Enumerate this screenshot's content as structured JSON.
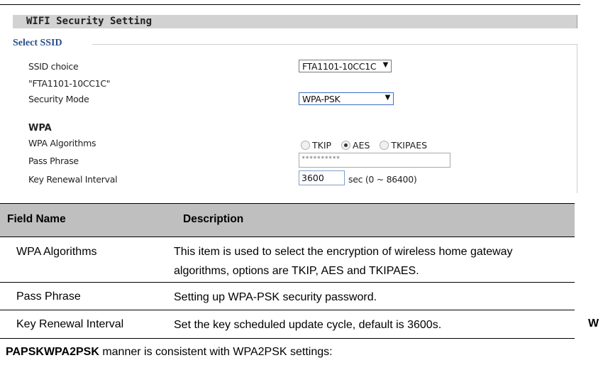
{
  "panel": {
    "title": "WIFI Security Setting",
    "legend": "Select SSID"
  },
  "form": {
    "ssid_choice_label": "SSID choice",
    "ssid_value": "FTA1101-10CC1C",
    "ssid_quoted": "\"FTA1101-10CC1C\"",
    "security_mode_label": "Security Mode",
    "security_mode_value": "WPA-PSK",
    "wpa_heading": "WPA",
    "wpa_algorithms_label": "WPA Algorithms",
    "algorithms": [
      {
        "label": "TKIP",
        "selected": false
      },
      {
        "label": "AES",
        "selected": true
      },
      {
        "label": "TKIPAES",
        "selected": false
      }
    ],
    "pass_phrase_label": "Pass Phrase",
    "pass_phrase_value": "**********",
    "key_renewal_label": "Key Renewal Interval",
    "key_renewal_value": "3600",
    "key_renewal_unit": "sec  (0 ~ 86400)"
  },
  "table": {
    "headers": [
      "Field Name",
      "Description"
    ],
    "rows": [
      {
        "name": "WPA Algorithms",
        "desc_lines": [
          "This item is used to select the encryption of wireless home gateway",
          "algorithms, options  are TKIP, AES and   TKIPAES."
        ]
      },
      {
        "name": "Pass Phrase",
        "desc_lines": [
          "Setting up WPA-PSK security   password."
        ]
      },
      {
        "name": "Key Renewal Interval",
        "desc_lines": [
          "Set the key scheduled update cycle, default is 3600s."
        ]
      }
    ]
  },
  "side_letter": "W",
  "footer": {
    "bold": "PAPSKWPA2PSK",
    "rest": " manner is consistent with WPA2PSK settings:"
  }
}
